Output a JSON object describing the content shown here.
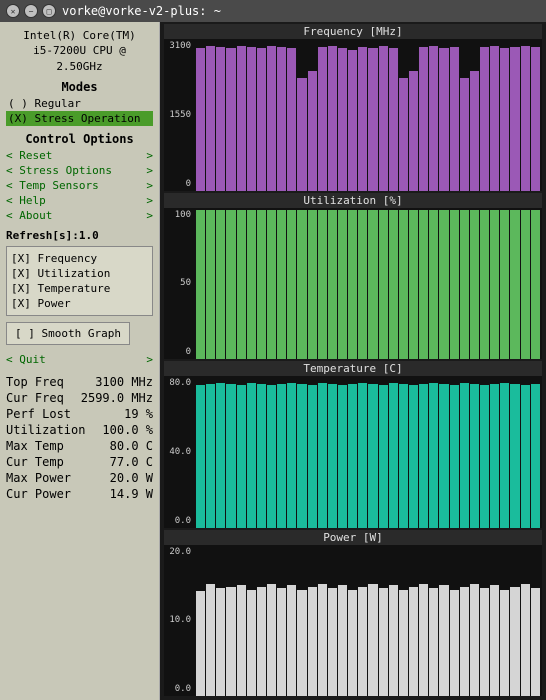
{
  "titleBar": {
    "title": "vorke@vorke-v2-plus: ~",
    "buttons": [
      "close",
      "minimize",
      "maximize"
    ]
  },
  "leftPanel": {
    "cpuInfo": "Intel(R) Core(TM)\ni5-7200U CPU @\n2.50GHz",
    "modesTitle": "Modes",
    "modes": [
      {
        "id": "regular",
        "label": "( ) Regular"
      },
      {
        "id": "stress",
        "label": "(X) Stress Operation",
        "active": true
      }
    ],
    "controlTitle": "Control Options",
    "controls": [
      {
        "label": "< Reset",
        "arrow": ">"
      },
      {
        "label": "< Stress Options",
        "arrow": ">"
      },
      {
        "label": "< Temp Sensors",
        "arrow": ">"
      },
      {
        "label": "< Help",
        "arrow": ">"
      },
      {
        "label": "< About",
        "arrow": ">"
      }
    ],
    "refreshLabel": "Refresh[s]:1.0",
    "checkboxes": [
      {
        "label": "[X] Frequency",
        "checked": true
      },
      {
        "label": "[X] Utilization",
        "checked": true
      },
      {
        "label": "[X] Temperature",
        "checked": true
      },
      {
        "label": "[X] Power",
        "checked": true
      }
    ],
    "smoothGraphBtn": "[ ] Smooth Graph",
    "quit": {
      "left": "< Quit",
      "right": ">"
    },
    "stats": [
      {
        "label": "Top Freq",
        "value": ""
      },
      {
        "label": "",
        "value": "3100 MHz"
      },
      {
        "label": "Cur Freq",
        "value": ""
      },
      {
        "label": "",
        "value": "2599.0 MHz"
      },
      {
        "label": "Perf Lost",
        "value": ""
      },
      {
        "label": "",
        "value": "19 %"
      },
      {
        "label": "Utilization",
        "value": ""
      },
      {
        "label": "",
        "value": "100.0 %"
      },
      {
        "label": "Max Temp",
        "value": ""
      },
      {
        "label": "",
        "value": "80.0 C"
      },
      {
        "label": "Cur Temp",
        "value": ""
      },
      {
        "label": "",
        "value": "77.0 C"
      },
      {
        "label": "Max Power",
        "value": ""
      },
      {
        "label": "",
        "value": "20.0 W"
      },
      {
        "label": "Cur Power",
        "value": ""
      },
      {
        "label": "",
        "value": "14.9 W"
      }
    ]
  },
  "charts": {
    "frequency": {
      "title": "Frequency [MHz]",
      "yLabels": [
        "3100",
        "1550",
        "0"
      ],
      "color": "#9b59b6",
      "bars": [
        95,
        97,
        96,
        95,
        97,
        96,
        95,
        97,
        96,
        95,
        75,
        80,
        96,
        97,
        95,
        94,
        96,
        95,
        97,
        95,
        75,
        80,
        96,
        97,
        95,
        96,
        75,
        80,
        96,
        97,
        95,
        96,
        97,
        96
      ]
    },
    "utilization": {
      "title": "Utilization [%]",
      "yLabels": [
        "100",
        "50",
        "0"
      ],
      "color": "#5cb85c",
      "bars": [
        100,
        100,
        100,
        100,
        100,
        100,
        100,
        100,
        100,
        100,
        100,
        100,
        100,
        100,
        100,
        100,
        100,
        100,
        100,
        100,
        100,
        100,
        100,
        100,
        100,
        100,
        100,
        100,
        100,
        100,
        100,
        100,
        100,
        100
      ]
    },
    "temperature": {
      "title": "Temperature [C]",
      "yLabels": [
        "80.0",
        "40.0",
        "0.0"
      ],
      "color": "#1abc9c",
      "bars": [
        95,
        96,
        97,
        96,
        95,
        97,
        96,
        95,
        96,
        97,
        96,
        95,
        97,
        96,
        95,
        96,
        97,
        96,
        95,
        97,
        96,
        95,
        96,
        97,
        96,
        95,
        97,
        96,
        95,
        96,
        97,
        96,
        95,
        96
      ]
    },
    "power": {
      "title": "Power [W]",
      "yLabels": [
        "20.0",
        "10.0",
        "0.0"
      ],
      "color": "#d5d5d5",
      "bars": [
        70,
        75,
        72,
        73,
        74,
        71,
        73,
        75,
        72,
        74,
        71,
        73,
        75,
        72,
        74,
        71,
        73,
        75,
        72,
        74,
        71,
        73,
        75,
        72,
        74,
        71,
        73,
        75,
        72,
        74,
        71,
        73,
        75,
        72
      ]
    }
  }
}
